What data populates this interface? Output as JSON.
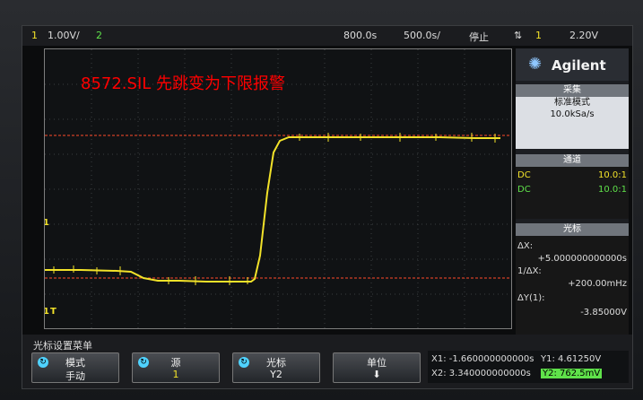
{
  "topbar": {
    "ch1_num": "1",
    "ch1_scale": "1.00V/",
    "ch2_num": "2",
    "time_pos": "800.0s",
    "timebase": "500.0s/",
    "status": "停止",
    "trigger_icon": "trigger-icon",
    "trig_ch": "1",
    "trig_level": "2.20V"
  },
  "annotation": "8572.SIL 先跳变为下限报警",
  "rightpanel": {
    "logo": "Agilent",
    "acq_title": "采集",
    "acq_mode": "标准模式",
    "acq_rate": "10.0kSa/s",
    "chan_title": "通道",
    "ch1_coupling": "DC",
    "ch1_probe": "10.0:1",
    "ch2_coupling": "DC",
    "ch2_probe": "10.0:1",
    "cursor_title": "光标",
    "dx_label": "ΔX:",
    "dx_val": "+5.000000000000s",
    "inv_dx_label": "1/ΔX:",
    "inv_dx_val": "+200.00mHz",
    "dy_label": "ΔY(1):",
    "dy_val": "-3.85000V"
  },
  "markers": {
    "ch1": "1",
    "gnd": "1",
    "trig": "T"
  },
  "menu": {
    "title": "光标设置菜单",
    "btn1_top": "模式",
    "btn1_bottom": "手动",
    "btn2_top": "源",
    "btn2_bottom": "1",
    "btn3_top": "光标",
    "btn3_bottom": "Y2",
    "btn4_top": "单位",
    "btn4_bottom": "⬇"
  },
  "readout": {
    "x1": "X1: -1.660000000000s",
    "x2": "X2: 3.340000000000s",
    "y1": "Y1: 4.61250V",
    "y2": "Y2: 762.5mV"
  },
  "colors": {
    "ch1": "#f2e229",
    "ch2": "#5fe24a",
    "cursor": "#ff4a2a"
  }
}
